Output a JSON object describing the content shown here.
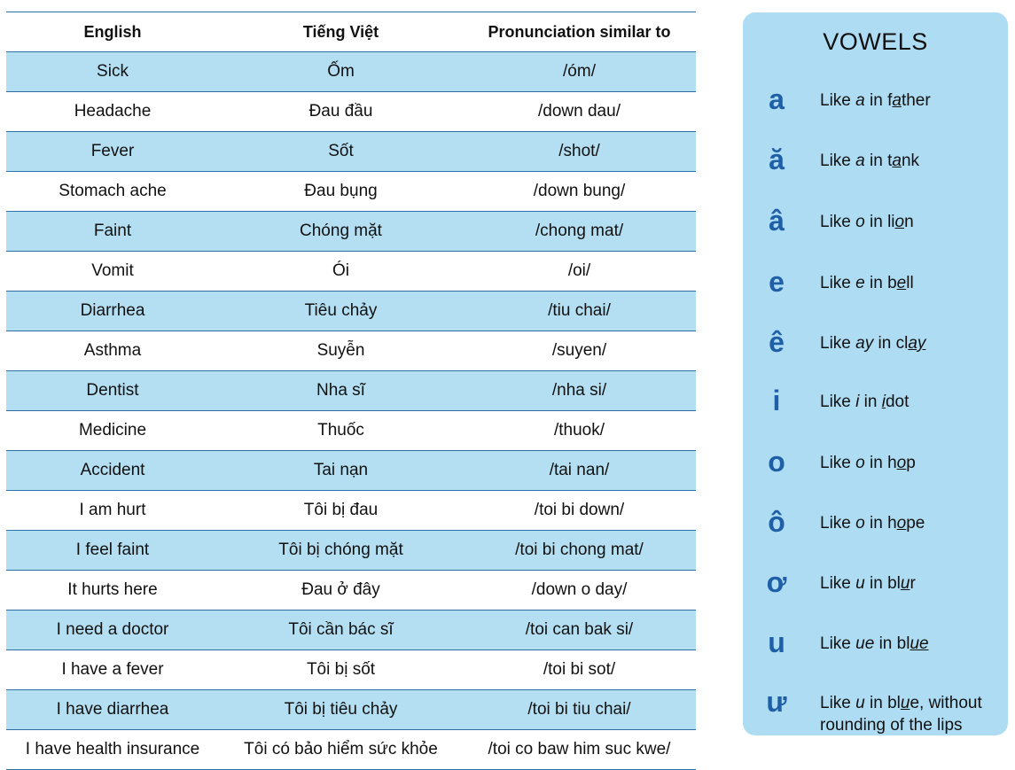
{
  "table": {
    "headers": {
      "english": "English",
      "vietnamese": "Tiếng Việt",
      "pronunciation": "Pronunciation similar to"
    },
    "rows": [
      {
        "en": "Sick",
        "vi": "Ốm",
        "pr": "/óm/"
      },
      {
        "en": "Headache",
        "vi": "Đau đầu",
        "pr": "/down dau/"
      },
      {
        "en": "Fever",
        "vi": "Sốt",
        "pr": "/shot/"
      },
      {
        "en": "Stomach ache",
        "vi": "Đau bụng",
        "pr": "/down bung/"
      },
      {
        "en": "Faint",
        "vi": "Chóng mặt",
        "pr": "/chong mat/"
      },
      {
        "en": "Vomit",
        "vi": "Ói",
        "pr": "/oi/"
      },
      {
        "en": "Diarrhea",
        "vi": "Tiêu chảy",
        "pr": "/tiu chai/"
      },
      {
        "en": "Asthma",
        "vi": "Suyễn",
        "pr": "/suyen/"
      },
      {
        "en": "Dentist",
        "vi": "Nha sĩ",
        "pr": "/nha si/"
      },
      {
        "en": "Medicine",
        "vi": "Thuốc",
        "pr": "/thuok/"
      },
      {
        "en": "Accident",
        "vi": "Tai nạn",
        "pr": "/tai nan/"
      },
      {
        "en": "I am hurt",
        "vi": "Tôi bị đau",
        "pr": "/toi bi down/"
      },
      {
        "en": "I feel faint",
        "vi": "Tôi bị chóng mặt",
        "pr": "/toi bi chong mat/"
      },
      {
        "en": "It hurts here",
        "vi": "Đau ở đây",
        "pr": "/down o day/"
      },
      {
        "en": "I need a doctor",
        "vi": "Tôi cần bác sĩ",
        "pr": "/toi can bak si/"
      },
      {
        "en": "I have a fever",
        "vi": "Tôi bị sốt",
        "pr": "/toi bi sot/"
      },
      {
        "en": "I have diarrhea",
        "vi": "Tôi bị tiêu chảy",
        "pr": "/toi bi tiu chai/"
      },
      {
        "en": "I have health insurance",
        "vi": "Tôi có bảo hiểm sức khỏe",
        "pr": "/toi co baw him suc kwe/"
      }
    ]
  },
  "vowels": {
    "title": "VOWELS",
    "items": [
      {
        "letter": "a",
        "like": "Like",
        "sound": "a",
        "in": "in",
        "pre": "f",
        "ul": "a",
        "post": "ther",
        "extra": ""
      },
      {
        "letter": "ă",
        "like": "Like",
        "sound": "a",
        "in": "in",
        "pre": "t",
        "ul": "a",
        "post": "nk",
        "extra": ""
      },
      {
        "letter": "â",
        "like": "Like",
        "sound": "o",
        "in": "in",
        "pre": "li",
        "ul": "o",
        "post": "n",
        "extra": ""
      },
      {
        "letter": "e",
        "like": "Like",
        "sound": "e",
        "in": "in",
        "pre": "b",
        "ul": "e",
        "post": "ll",
        "extra": ""
      },
      {
        "letter": "ê",
        "like": "Like",
        "sound": "ay",
        "in": "in",
        "pre": "cl",
        "ul": "ay",
        "post": "",
        "extra": ""
      },
      {
        "letter": "i",
        "like": "Like",
        "sound": "i",
        "in": "in",
        "pre": "",
        "ul": "i",
        "post": "dot",
        "extra": ""
      },
      {
        "letter": "o",
        "like": "Like",
        "sound": "o",
        "in": "in",
        "pre": "h",
        "ul": "o",
        "post": "p",
        "extra": ""
      },
      {
        "letter": "ô",
        "like": "Like",
        "sound": "o",
        "in": "in",
        "pre": "h",
        "ul": "o",
        "post": "pe",
        "extra": ""
      },
      {
        "letter": "ơ",
        "like": "Like",
        "sound": "u",
        "in": "in",
        "pre": "bl",
        "ul": "u",
        "post": "r",
        "extra": ""
      },
      {
        "letter": "u",
        "like": "Like",
        "sound": "ue",
        "in": "in",
        "pre": "bl",
        "ul": "ue",
        "post": "",
        "extra": ""
      },
      {
        "letter": "ư",
        "like": "Like",
        "sound": "u",
        "in": "in",
        "pre": "bl",
        "ul": "u",
        "post": "e, without rounding of the lips",
        "extra": ""
      }
    ]
  },
  "colors": {
    "row_shade": "#b4dff2",
    "panel_bg": "#aedcf3",
    "vowel_letter": "#1f5fa6",
    "rule": "#2c6fa3"
  }
}
